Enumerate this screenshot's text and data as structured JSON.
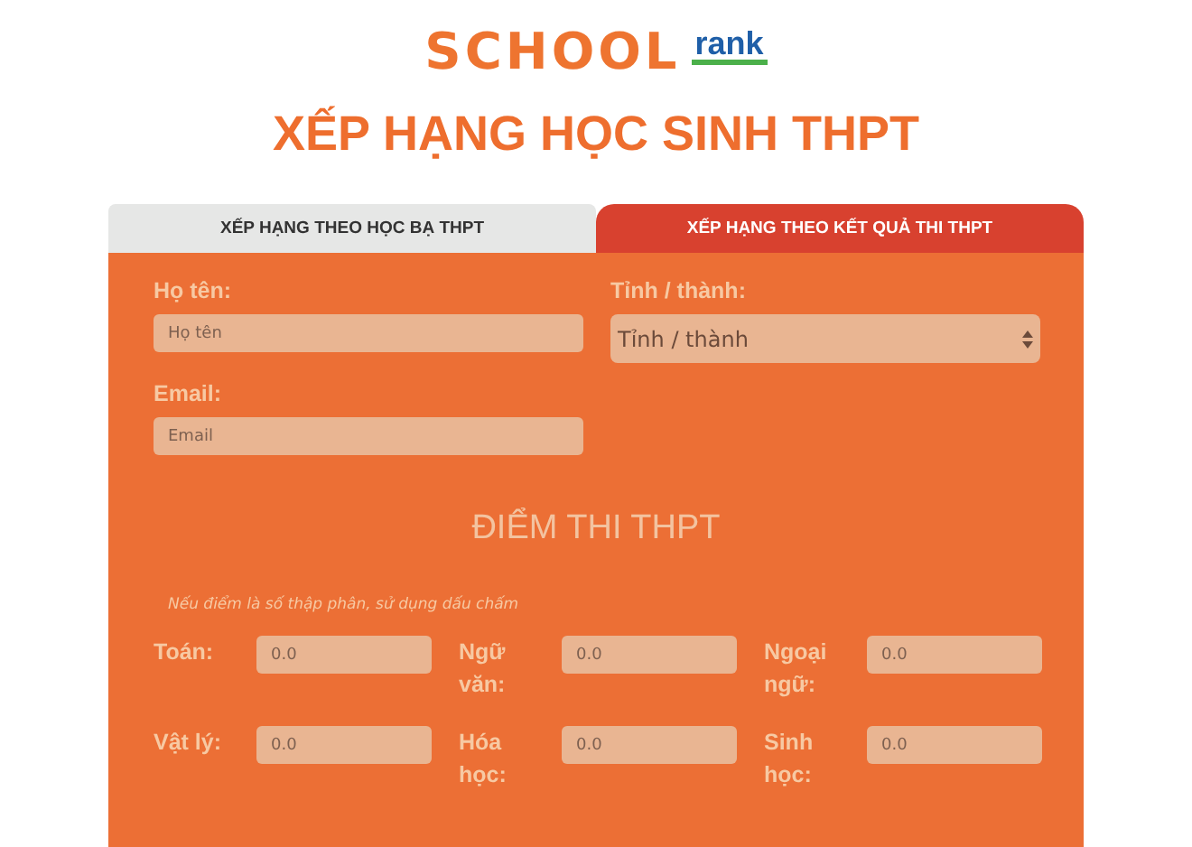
{
  "logo": {
    "word": "SCHOOL",
    "badge": "rank"
  },
  "title": "XẾP HẠNG HỌC SINH THPT",
  "tabs": [
    {
      "label": "XẾP HẠNG THEO HỌC BẠ THPT",
      "selected": false
    },
    {
      "label": "XẾP HẠNG THEO KẾT QUẢ THI THPT",
      "selected": true
    }
  ],
  "form": {
    "name": {
      "label": "Họ tên:",
      "placeholder": "Họ tên"
    },
    "province": {
      "label": "Tỉnh / thành:",
      "value": "Tỉnh / thành"
    },
    "email": {
      "label": "Email:",
      "placeholder": "Email"
    }
  },
  "scores": {
    "heading": "ĐIỂM THI THPT",
    "note": "Nếu điểm là số thập phân, sử dụng dấu chấm",
    "subjects": [
      {
        "label": "Toán:",
        "placeholder": "0.0"
      },
      {
        "label": "Ngữ văn:",
        "placeholder": "0.0"
      },
      {
        "label": "Ngoại ngữ:",
        "placeholder": "0.0"
      },
      {
        "label": "Vật lý:",
        "placeholder": "0.0"
      },
      {
        "label": "Hóa học:",
        "placeholder": "0.0"
      },
      {
        "label": "Sinh học:",
        "placeholder": "0.0"
      }
    ]
  }
}
